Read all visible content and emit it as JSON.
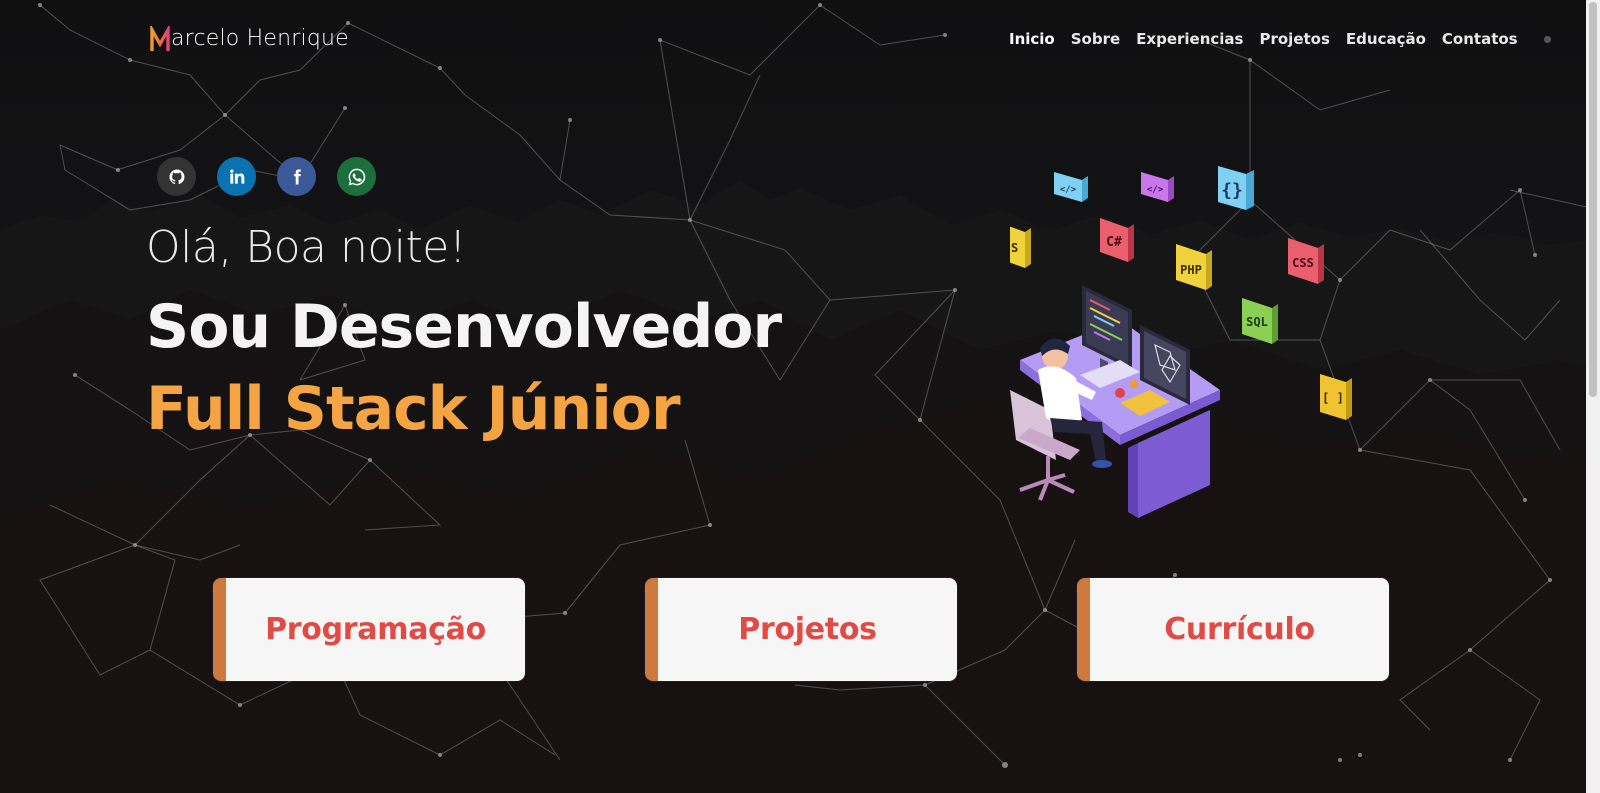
{
  "logo": {
    "text": "arcelo Henrique",
    "mark": "M"
  },
  "nav": {
    "items": [
      {
        "label": "Inicio",
        "active": true
      },
      {
        "label": "Sobre"
      },
      {
        "label": "Experiencias"
      },
      {
        "label": "Projetos"
      },
      {
        "label": "Educação"
      },
      {
        "label": "Contatos"
      }
    ]
  },
  "social": [
    {
      "name": "github-icon",
      "color": "#333333"
    },
    {
      "name": "linkedin-icon",
      "color": "#0a72b1"
    },
    {
      "name": "facebook-icon",
      "color": "#3b5998"
    },
    {
      "name": "whatsapp-icon",
      "color": "#1d6e3d"
    }
  ],
  "hero": {
    "greeting": "Olá, Boa noite!",
    "line1": "Sou Desenvolvedor",
    "line2": "Full Stack Júnior"
  },
  "illustration": {
    "tags": [
      "</>",
      "</>",
      "{}",
      "JS",
      "C#",
      "PHP",
      "CSS",
      "SQL",
      "[ ]"
    ]
  },
  "cards": [
    {
      "label": "Programação"
    },
    {
      "label": "Projetos"
    },
    {
      "label": "Currículo"
    }
  ],
  "colors": {
    "accent_orange": "#f4a442",
    "card_text": "#e14b45",
    "card_border": "#cd7a3f"
  }
}
